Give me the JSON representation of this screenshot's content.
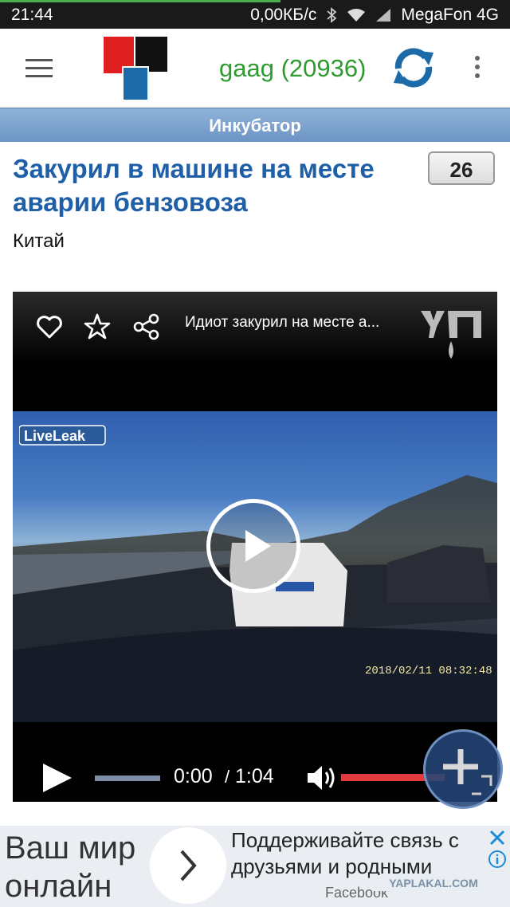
{
  "status_bar": {
    "time": "21:44",
    "speed": "0,00КБ/с",
    "carrier": "MegaFon 4G",
    "icons": [
      "bluetooth-icon",
      "wifi-icon",
      "signal-icon"
    ]
  },
  "app_bar": {
    "username": "gaag (20936)",
    "icons": [
      "menu-icon",
      "logo",
      "refresh-icon",
      "more-vert-icon"
    ]
  },
  "section": {
    "title": "Инкубатор"
  },
  "article": {
    "title": "Закурил в машине на месте аварии бензовоза",
    "comment_count": "26",
    "subtitle": "Китай"
  },
  "video": {
    "caption": "Идиот закурил на месте а...",
    "watermark": "LiveLeak",
    "timestamp": "2018/02/11  08:32:48",
    "time_current": "0:00",
    "time_separator": "/",
    "time_total": "1:04",
    "progress": 0.0,
    "volume": 0.85,
    "icons": [
      "heart-icon",
      "star-icon",
      "share-icon",
      "yap-logo-icon",
      "play-icon",
      "volume-icon"
    ]
  },
  "ad": {
    "left_text": "Ваш мир онлайн",
    "right_text": "Поддерживайте связь с друзьями и родными",
    "source": "Facebook",
    "watermark": "YAPLAKAL.COM"
  },
  "colors": {
    "accent_green": "#2e9b2e",
    "title_blue": "#1f5fa8",
    "section_bar": "#7aa0cf",
    "volume_red": "#e0393e"
  }
}
